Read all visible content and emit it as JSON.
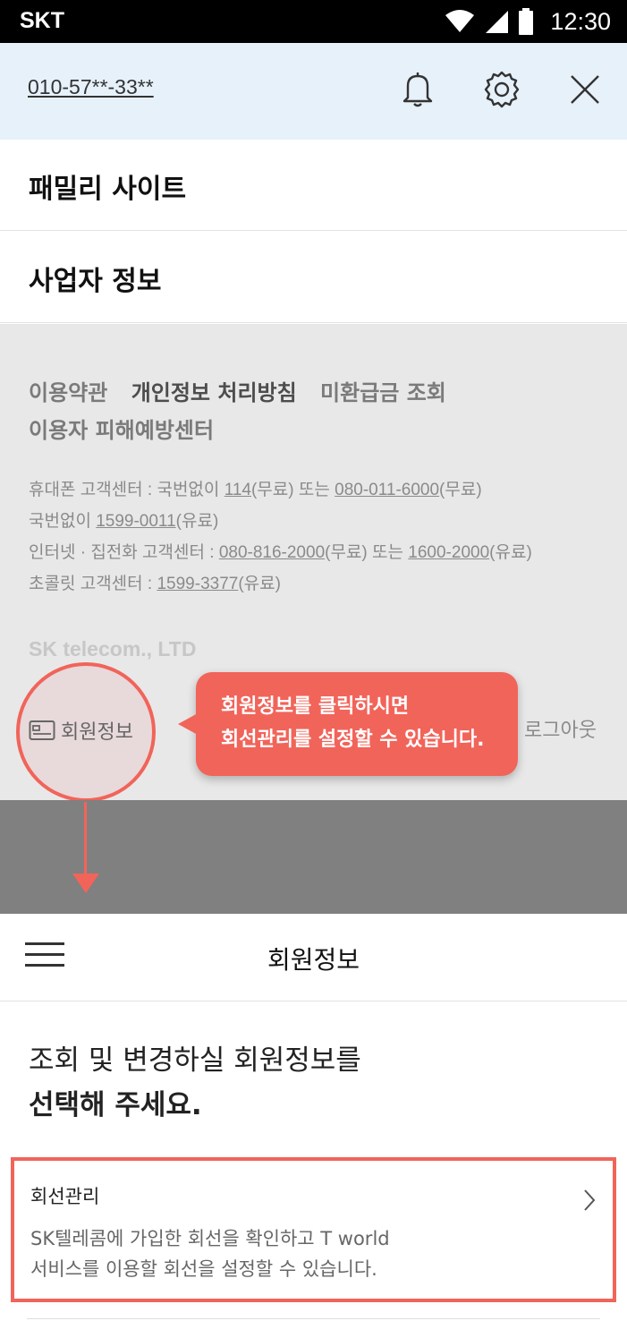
{
  "status_bar": {
    "carrier": "SKT",
    "time": "12:30",
    "icons": [
      "wifi-icon",
      "signal-icon",
      "battery-icon"
    ]
  },
  "top_bar": {
    "phone_number": "010-57**-33**",
    "icons": [
      "bell-icon",
      "gear-icon",
      "close-icon"
    ]
  },
  "menu": {
    "family_site": "패밀리 사이트",
    "business_info": "사업자 정보"
  },
  "footer": {
    "links": {
      "terms": "이용약관",
      "privacy": "개인정보 처리방침",
      "refund": "미환급금 조회",
      "protection": "이용자 피해예방센터"
    },
    "contacts": {
      "line1_prefix": "휴대폰 고객센터 : 국번없이 ",
      "line1_num1": "114",
      "line1_mid": "(무료) 또는 ",
      "line1_num2": "080-011-6000",
      "line1_suffix": "(무료)",
      "line2_prefix": "국번없이 ",
      "line2_num": "1599-0011",
      "line2_suffix": "(유료)",
      "line3_prefix": "인터넷 · 집전화 고객센터 : ",
      "line3_num1": "080-816-2000",
      "line3_mid": "(무료) 또는 ",
      "line3_num2": "1600-2000",
      "line3_suffix": "(유료)",
      "line4_prefix": "초콜릿 고객센터 : ",
      "line4_num": "1599-3377",
      "line4_suffix": "(유료)"
    },
    "company": "SK telecom., LTD",
    "member_info": "회원정보",
    "logout": "로그아웃"
  },
  "tooltip": {
    "line1": "회원정보를 클릭하시면",
    "line2": "회선관리를 설정할 수 있습니다."
  },
  "member_page": {
    "header_title": "회원정보",
    "prompt_line1": "조회 및 변경하실 회원정보를",
    "prompt_line2": "선택해 주세요.",
    "card": {
      "title": "회선관리",
      "desc_line1": "SK텔레콤에 가입한 회선을 확인하고 T world",
      "desc_line2": "서비스를 이용할 회선을 설정할 수 있습니다."
    }
  },
  "colors": {
    "accent": "#f1645a",
    "top_bar_bg": "#e6f1fa",
    "footer_bg": "#e8e8e8",
    "dim_overlay": "#808080"
  }
}
